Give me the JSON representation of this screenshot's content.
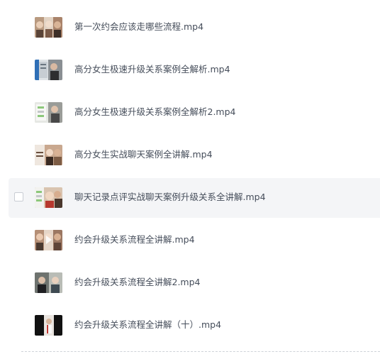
{
  "files": [
    {
      "name": "第一次约会应该走哪些流程.mp4",
      "thumbnail": "video-thumbnail-icon"
    },
    {
      "name": "高分女生极速升级关系案例全解析.mp4",
      "thumbnail": "video-thumbnail-icon"
    },
    {
      "name": "高分女生极速升级关系案例全解析2.mp4",
      "thumbnail": "video-thumbnail-icon"
    },
    {
      "name": "高分女生实战聊天案例全讲解.mp4",
      "thumbnail": "video-thumbnail-icon"
    },
    {
      "name": "聊天记录点评实战聊天案例升级关系全讲解.mp4",
      "thumbnail": "video-thumbnail-icon",
      "hovered": true
    },
    {
      "name": "约会升级关系流程全讲解.mp4",
      "thumbnail": "video-thumbnail-icon"
    },
    {
      "name": "约会升级关系流程全讲解2.mp4",
      "thumbnail": "video-thumbnail-icon"
    },
    {
      "name": "约会升级关系流程全讲解（十）.mp4",
      "thumbnail": "video-thumbnail-icon"
    }
  ],
  "colors": {
    "text": "#454d5a",
    "hover_background": "#f4f5f7",
    "checkbox_border": "#c9cdd4",
    "divider": "#cfd3d9"
  }
}
